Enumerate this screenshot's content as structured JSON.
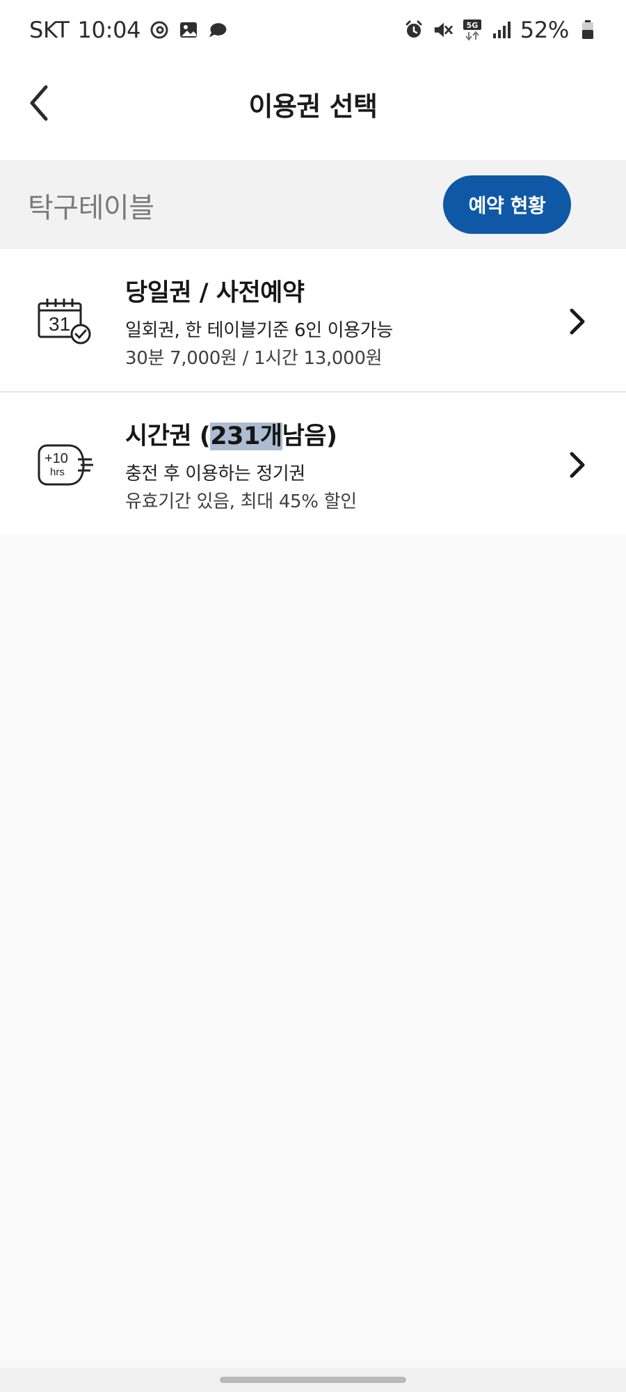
{
  "status_bar": {
    "carrier": "SKT",
    "time": "10:04",
    "network_badge": "5G",
    "battery": "52%",
    "icons": [
      "threads-icon",
      "gallery-icon",
      "chat-bubble-icon",
      "alarm-icon",
      "mute-icon",
      "network-5g-icon",
      "signal-icon",
      "battery-icon"
    ]
  },
  "header": {
    "title": "이용권 선택",
    "back_icon": "chevron-left-icon"
  },
  "section": {
    "title": "탁구테이블",
    "reservation_button": "예약 현황",
    "accent_color": "#0f58a6"
  },
  "tickets": [
    {
      "title": "당일권 / 사전예약",
      "description": "일회권, 한 테이블기준 6인 이용가능",
      "detail": "30분 7,000원 / 1시간 13,000원",
      "icon": "calendar-check-icon",
      "icon_text": "31"
    },
    {
      "title_prefix": "시간권  (",
      "title_count": "231개",
      "title_suffix": "남음)",
      "description": "충전 후 이용하는 정기권",
      "detail": "유효기간 있음, 최대 45% 할인",
      "icon": "time-pass-icon",
      "icon_text_top": "+10",
      "icon_text_bottom": "hrs"
    }
  ]
}
